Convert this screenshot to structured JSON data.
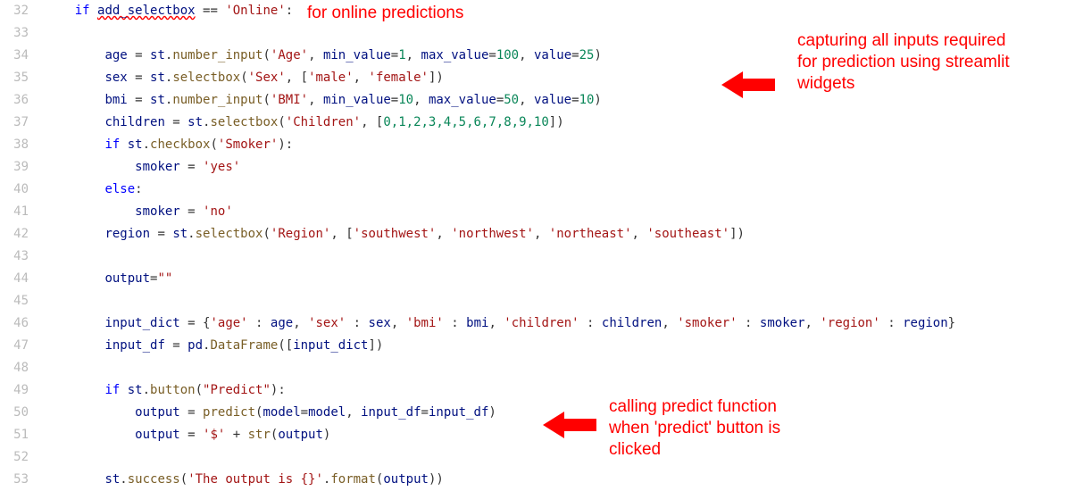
{
  "gutter_start": 32,
  "tokens": {
    "if": "if",
    "else": "else",
    "eq": " == ",
    "colon": ":",
    "assign": " = ",
    "add_selectbox": "add_selectbox",
    "online": "'Online'",
    "age": "age",
    "sex": "sex",
    "bmi": "bmi",
    "children": "children",
    "smoker_var": "smoker",
    "region": "region",
    "output": "output",
    "input_dict": "input_dict",
    "input_df": "input_df",
    "st": "st",
    "pd": "pd",
    "number_input": "number_input",
    "selectbox": "selectbox",
    "checkbox": "checkbox",
    "button": "button",
    "DataFrame": "DataFrame",
    "success": "success",
    "predict": "predict",
    "format": "format",
    "str_fn": "str",
    "Age": "'Age'",
    "Sex": "'Sex'",
    "BMI": "'BMI'",
    "Children": "'Children'",
    "Smoker": "'Smoker'",
    "Region": "'Region'",
    "Predict": "\"Predict\"",
    "male": "'male'",
    "female": "'female'",
    "yes": "'yes'",
    "no": "'no'",
    "southwest": "'southwest'",
    "northwest": "'northwest'",
    "northeast": "'northeast'",
    "southeast": "'southeast'",
    "k_age": "'age'",
    "k_sex": "'sex'",
    "k_bmi": "'bmi'",
    "k_children": "'children'",
    "k_smoker": "'smoker'",
    "k_region": "'region'",
    "min_value": "min_value",
    "max_value": "max_value",
    "value": "value",
    "model": "model",
    "empty": "\"\"",
    "dollar": "'$' ",
    "success_msg": "'The output is {}'",
    "n1": "1",
    "n10": "10",
    "n25": "25",
    "n50": "50",
    "n100": "100",
    "list_children": "0,1,2,3,4,5,6,7,8,9,10",
    "plus": "+ "
  },
  "annotations": {
    "a1": "for online predictions",
    "a2": "capturing all inputs required for prediction using streamlit widgets",
    "a3": "calling predict function when 'predict' button is clicked"
  },
  "colors": {
    "red": "#ff0000",
    "keyword": "#0000ff",
    "function": "#795e26",
    "string": "#a31515",
    "number": "#098658"
  }
}
